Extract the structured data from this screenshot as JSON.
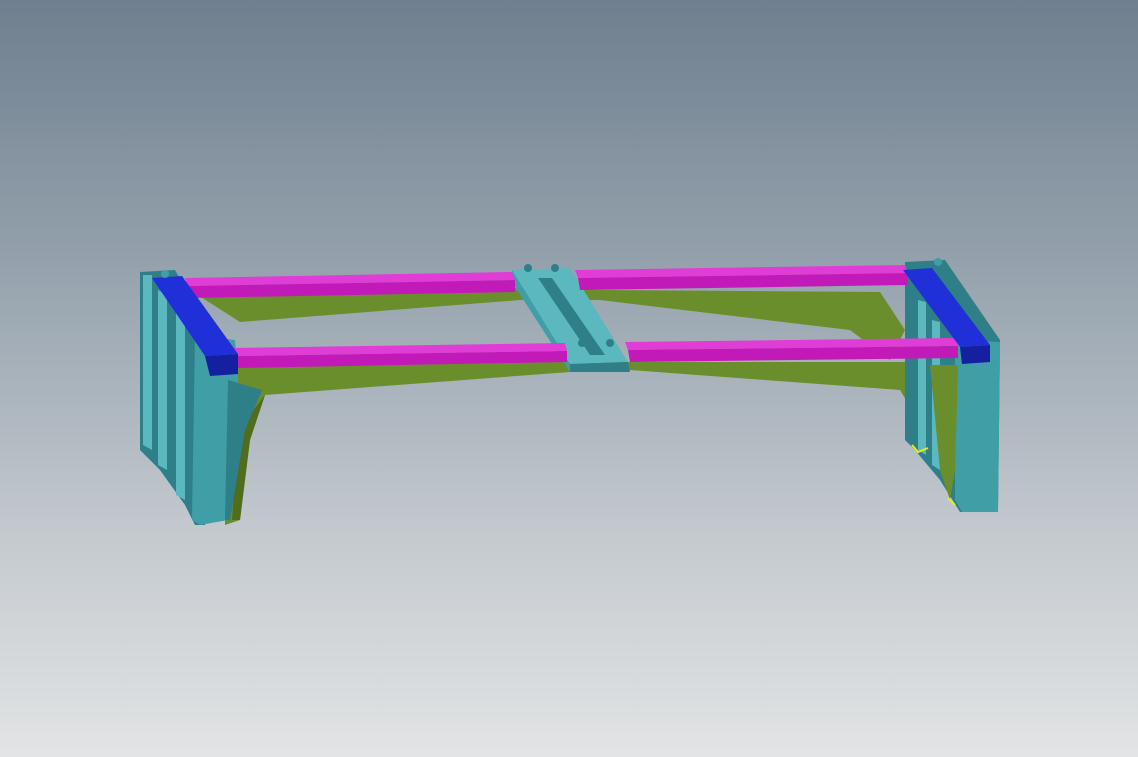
{
  "colors": {
    "background_top": "#6f7f8f",
    "background_bottom": "#e2e4e5",
    "frame_teal": "#3f9ea6",
    "frame_teal_dark": "#2e7f87",
    "frame_teal_light": "#5cb8bf",
    "web_olive": "#6b8e2c",
    "web_olive_dark": "#4f6d1c",
    "rail_magenta": "#c21ab8",
    "rail_magenta_dark": "#8e1288",
    "rail_magenta_light": "#e03cd6",
    "endcap_blue": "#2030d8",
    "endcap_blue_dark": "#1420a0",
    "marker_yellow": "#e8ec1c"
  },
  "scene": {
    "view": "3d-isometric",
    "object": "welded-frame-assembly",
    "components": [
      "left-leg-assembly",
      "right-leg-assembly",
      "center-connector",
      "rear-rails",
      "front-rails",
      "end-caps",
      "olive-webs"
    ]
  }
}
